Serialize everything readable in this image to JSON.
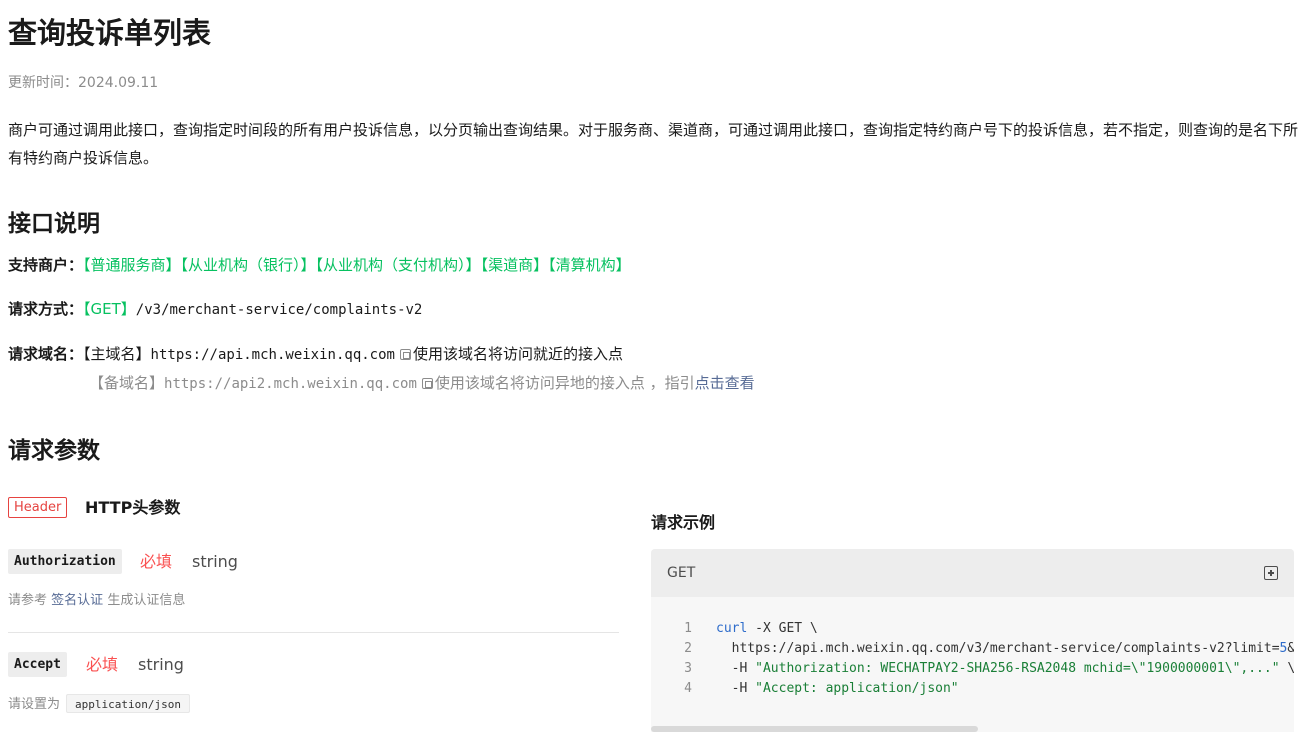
{
  "page": {
    "title": "查询投诉单列表",
    "update_time": "更新时间：2024.09.11",
    "intro": "商户可通过调用此接口，查询指定时间段的所有用户投诉信息，以分页输出查询结果。对于服务商、渠道商，可通过调用此接口，查询指定特约商户号下的投诉信息，若不指定，则查询的是名下所有特约商户投诉信息。"
  },
  "interface": {
    "title": "接口说明",
    "merchants_label": "支持商户：",
    "merchants": [
      "【普通服务商】",
      "【从业机构（银行）】",
      "【从业机构（支付机构）】",
      "【渠道商】",
      "【清算机构】"
    ],
    "method_label": "请求方式：",
    "method": "【GET】",
    "path": "/v3/merchant-service/complaints-v2",
    "domain_label": "请求域名：",
    "primary_prefix": "【主域名】",
    "primary_url": "https://api.mch.weixin.qq.com",
    "primary_note": "使用该域名将访问就近的接入点",
    "backup_prefix": "【备域名】",
    "backup_url": "https://api2.mch.weixin.qq.com",
    "backup_note": "使用该域名将访问异地的接入点 ，指引",
    "backup_link": "点击查看"
  },
  "params": {
    "title": "请求参数",
    "header_tag": "Header",
    "header_label": "HTTP头参数",
    "items": [
      {
        "name": "Authorization",
        "required": "必填",
        "type": "string",
        "desc_prefix": "请参考",
        "desc_link": "签名认证",
        "desc_suffix": "生成认证信息"
      },
      {
        "name": "Accept",
        "required": "必填",
        "type": "string",
        "desc_prefix": "请设置为",
        "desc_code": "application/json"
      }
    ]
  },
  "example": {
    "title": "请求示例",
    "method": "GET",
    "copy_icon": "copy-icon",
    "lines": [
      {
        "n": "1",
        "cmd": "curl",
        "rest": " -X GET \\"
      },
      {
        "n": "2",
        "text": "  https://api.mch.weixin.qq.com/v3/merchant-service/complaints-v2?limit=",
        "num": "5",
        "tail": "&o"
      },
      {
        "n": "3",
        "pre": "  -H ",
        "str": "\"Authorization: WECHATPAY2-SHA256-RSA2048 mchid=\\\"1900000001\\\",...\"",
        "post": " \\"
      },
      {
        "n": "4",
        "pre": "  -H ",
        "str": "\"Accept: application/json\""
      }
    ]
  },
  "colors": {
    "green": "#07c160",
    "red": "#fa5151",
    "link": "#576b95"
  }
}
